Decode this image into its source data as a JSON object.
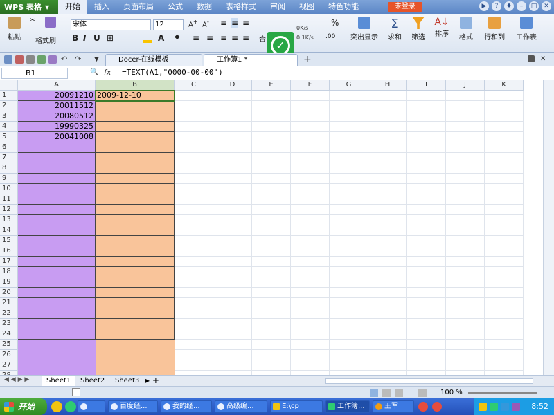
{
  "menubar": {
    "app_name": "WPS 表格",
    "items": [
      "开始",
      "插入",
      "页面布局",
      "公式",
      "数据",
      "表格样式",
      "审阅",
      "视图",
      "特色功能"
    ],
    "login": "未登录"
  },
  "ribbon": {
    "paste": "粘贴",
    "format_painter": "格式刷",
    "font_name": "宋体",
    "font_size": "12",
    "merge": "合",
    "speed_up": "0K/s",
    "speed_down": "0.1K/s",
    "highlight": "突出显示",
    "sum": "求和",
    "filter": "筛选",
    "sort": "排序",
    "format": "格式",
    "row_col": "行和列",
    "worksheet": "工作表"
  },
  "tabs": {
    "docer": "Docer-在线模板",
    "workbook": "工作簿1 *"
  },
  "formulabar": {
    "namebox": "B1",
    "fx": "fx",
    "formula": "=TEXT(A1,\"0000-00-00\")"
  },
  "grid": {
    "columns": [
      "A",
      "B",
      "C",
      "D",
      "E",
      "F",
      "G",
      "H",
      "I",
      "J",
      "K"
    ],
    "rows": [
      "1",
      "2",
      "3",
      "4",
      "5",
      "6",
      "7",
      "8",
      "9",
      "10",
      "11",
      "12",
      "13",
      "14",
      "15",
      "16",
      "17",
      "18",
      "19",
      "20",
      "21",
      "22",
      "23",
      "24",
      "25",
      "26",
      "27",
      "28"
    ],
    "colA": [
      "20091210",
      "20011512",
      "20080512",
      "19990325",
      "20041008"
    ],
    "colB": [
      "2009-12-10"
    ]
  },
  "sheets": [
    "Sheet1",
    "Sheet2",
    "Sheet3"
  ],
  "status": {
    "zoom": "100 %"
  },
  "taskbar": {
    "start": "开始",
    "items": [
      "百度经...",
      "我的经...",
      "高级编...",
      "E:\\cp",
      "工作簿...",
      "王军"
    ],
    "clock": "8:52"
  }
}
